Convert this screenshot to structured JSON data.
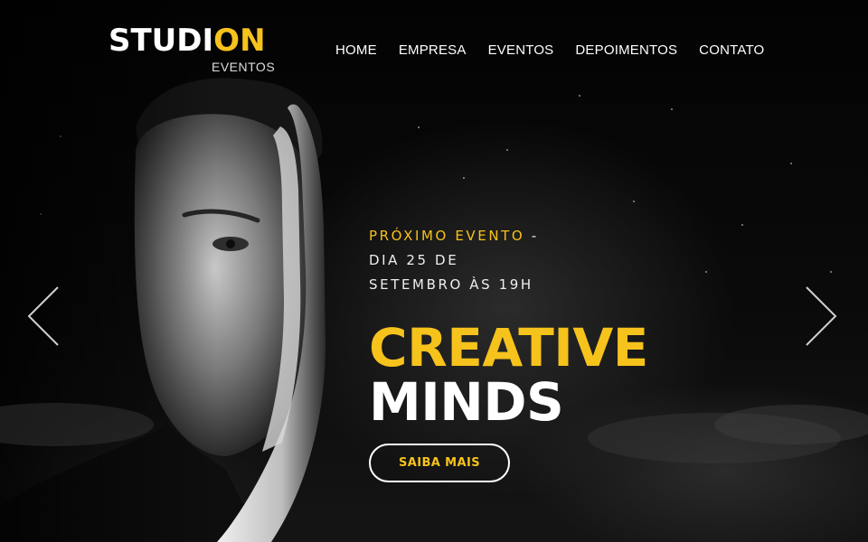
{
  "brand": {
    "name_part1": "STUDI",
    "name_part2": "ON",
    "tagline": "EVENTOS",
    "accent_color": "#f6c21c"
  },
  "nav": {
    "items": [
      {
        "label": "HOME"
      },
      {
        "label": "EMPRESA"
      },
      {
        "label": "EVENTOS"
      },
      {
        "label": "DEPOIMENTOS"
      },
      {
        "label": "CONTATO"
      }
    ]
  },
  "slider": {
    "prev_icon": "chevron-left-icon",
    "next_icon": "chevron-right-icon"
  },
  "event": {
    "label": "PRÓXIMO EVENTO",
    "separator": " -",
    "date_line1": "DIA 25 DE",
    "date_line2": "SETEMBRO ÀS 19H",
    "title_line1": "CREATIVE",
    "title_line2": "MINDS",
    "cta_label": "SAIBA MAIS"
  }
}
